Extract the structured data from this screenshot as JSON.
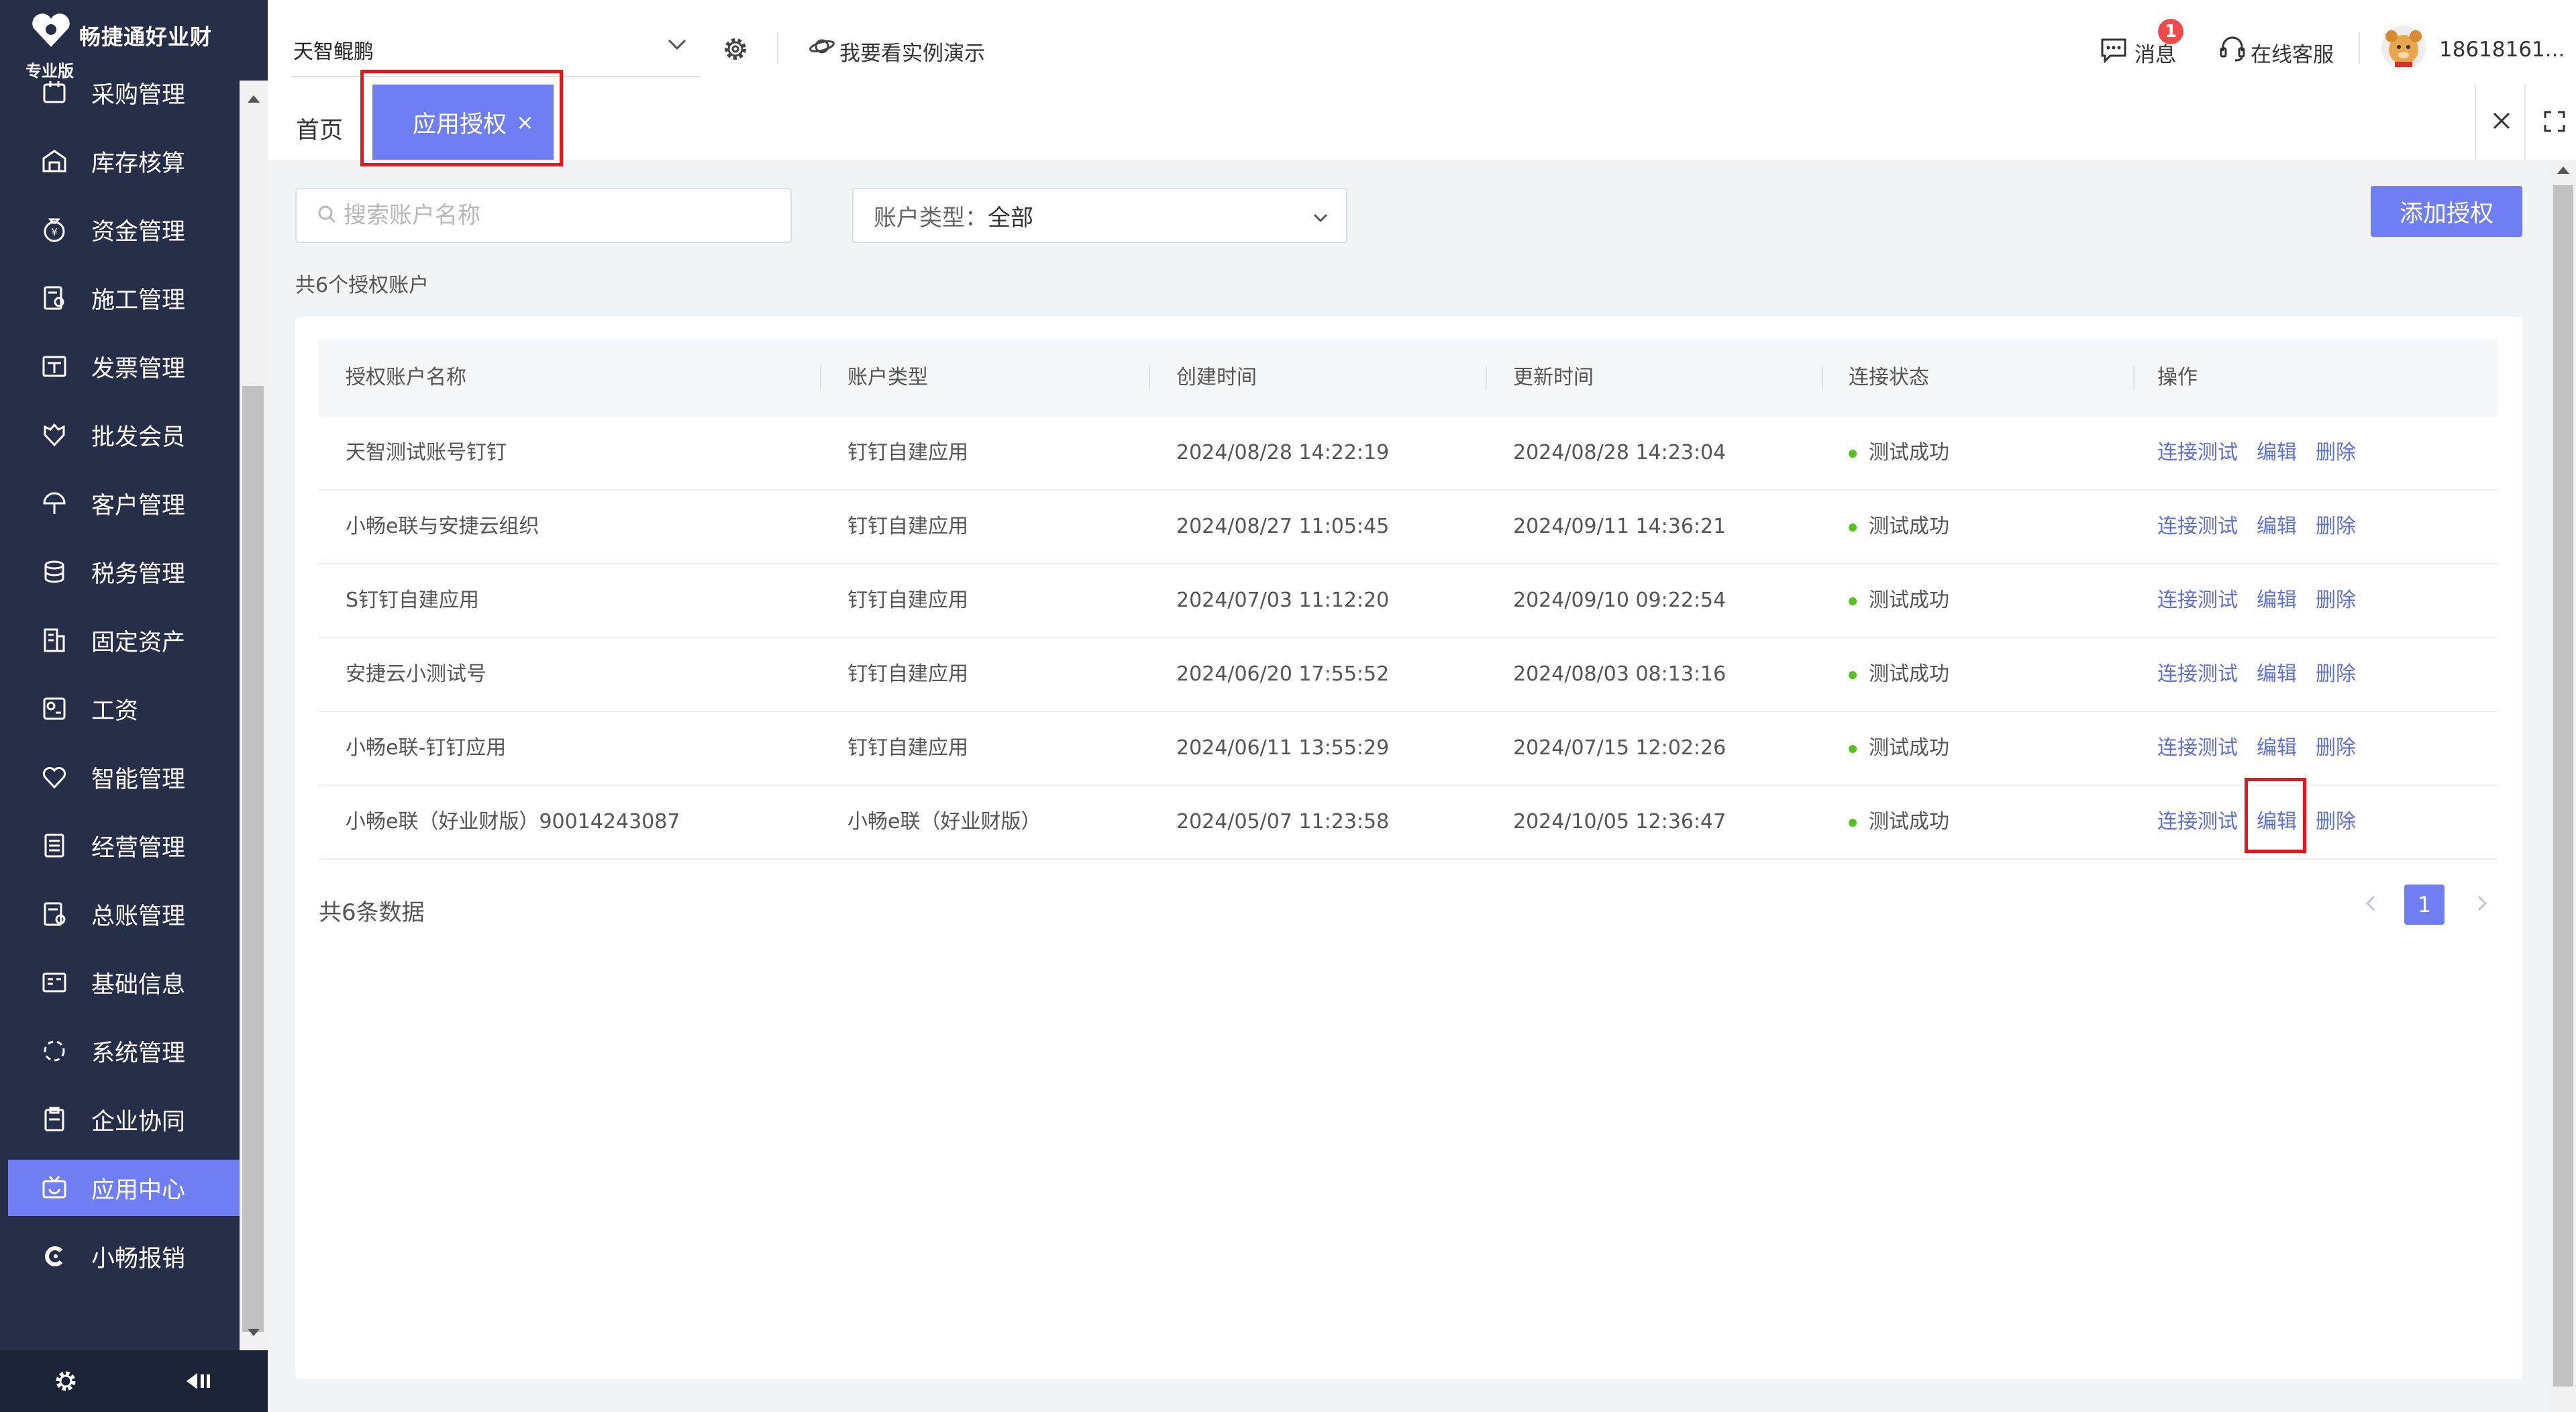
{
  "brand": {
    "name": "畅捷通好业财",
    "edition": "专业版"
  },
  "sidebar": {
    "items": [
      {
        "label": "采购管理",
        "icon": "purchase-icon"
      },
      {
        "label": "库存核算",
        "icon": "warehouse-icon"
      },
      {
        "label": "资金管理",
        "icon": "money-bag-icon"
      },
      {
        "label": "施工管理",
        "icon": "construction-doc-icon"
      },
      {
        "label": "发票管理",
        "icon": "invoice-icon"
      },
      {
        "label": "批发会员",
        "icon": "member-icon"
      },
      {
        "label": "客户管理",
        "icon": "customer-icon"
      },
      {
        "label": "税务管理",
        "icon": "tax-icon"
      },
      {
        "label": "固定资产",
        "icon": "building-icon"
      },
      {
        "label": "工资",
        "icon": "salary-icon"
      },
      {
        "label": "智能管理",
        "icon": "heart-icon"
      },
      {
        "label": "经营管理",
        "icon": "report-icon"
      },
      {
        "label": "总账管理",
        "icon": "ledger-icon"
      },
      {
        "label": "基础信息",
        "icon": "id-card-icon"
      },
      {
        "label": "系统管理",
        "icon": "loading-circle-icon"
      },
      {
        "label": "企业协同",
        "icon": "clipboard-icon"
      },
      {
        "label": "应用中心",
        "icon": "tv-app-icon",
        "active": true
      },
      {
        "label": "小畅报销",
        "icon": "c-logo-icon"
      }
    ]
  },
  "header": {
    "company": "天智鲲鹏",
    "demo_link": "我要看实例演示",
    "messages_label": "消息",
    "messages_badge": "1",
    "service_label": "在线客服",
    "user_name": "18618161..."
  },
  "tabs": {
    "home": "首页",
    "active": "应用授权",
    "close_symbol": "×"
  },
  "filters": {
    "search_placeholder": "搜索账户名称",
    "type_label": "账户类型：",
    "type_value": "全部"
  },
  "actions": {
    "add_label": "添加授权"
  },
  "summary": {
    "count_text": "共6个授权账户"
  },
  "table": {
    "headers": [
      "授权账户名称",
      "账户类型",
      "创建时间",
      "更新时间",
      "连接状态",
      "操作"
    ],
    "rows": [
      {
        "name": "天智测试账号钉钉",
        "type": "钉钉自建应用",
        "created": "2024/08/28 14:22:19",
        "updated": "2024/08/28 14:23:04",
        "status": "测试成功"
      },
      {
        "name": "小畅e联与安捷云组织",
        "type": "钉钉自建应用",
        "created": "2024/08/27 11:05:45",
        "updated": "2024/09/11 14:36:21",
        "status": "测试成功"
      },
      {
        "name": "S钉钉自建应用",
        "type": "钉钉自建应用",
        "created": "2024/07/03 11:12:20",
        "updated": "2024/09/10 09:22:54",
        "status": "测试成功"
      },
      {
        "name": "安捷云小测试号",
        "type": "钉钉自建应用",
        "created": "2024/06/20 17:55:52",
        "updated": "2024/08/03 08:13:16",
        "status": "测试成功"
      },
      {
        "name": "小畅e联-钉钉应用",
        "type": "钉钉自建应用",
        "created": "2024/06/11 13:55:29",
        "updated": "2024/07/15 12:02:26",
        "status": "测试成功"
      },
      {
        "name": "小畅e联（好业财版）90014243087",
        "type": "小畅e联（好业财版）",
        "created": "2024/05/07 11:23:58",
        "updated": "2024/10/05 12:36:47",
        "status": "测试成功"
      }
    ],
    "op_test": "连接测试",
    "op_edit": "编辑",
    "op_delete": "删除"
  },
  "footer": {
    "total_text": "共6条数据",
    "current_page": "1"
  },
  "colors": {
    "accent": "#6f7ef2",
    "sidebar_bg": "#262e48",
    "highlight": "#e8161c",
    "status_ok": "#52c41a",
    "link": "#5b6fe0"
  }
}
